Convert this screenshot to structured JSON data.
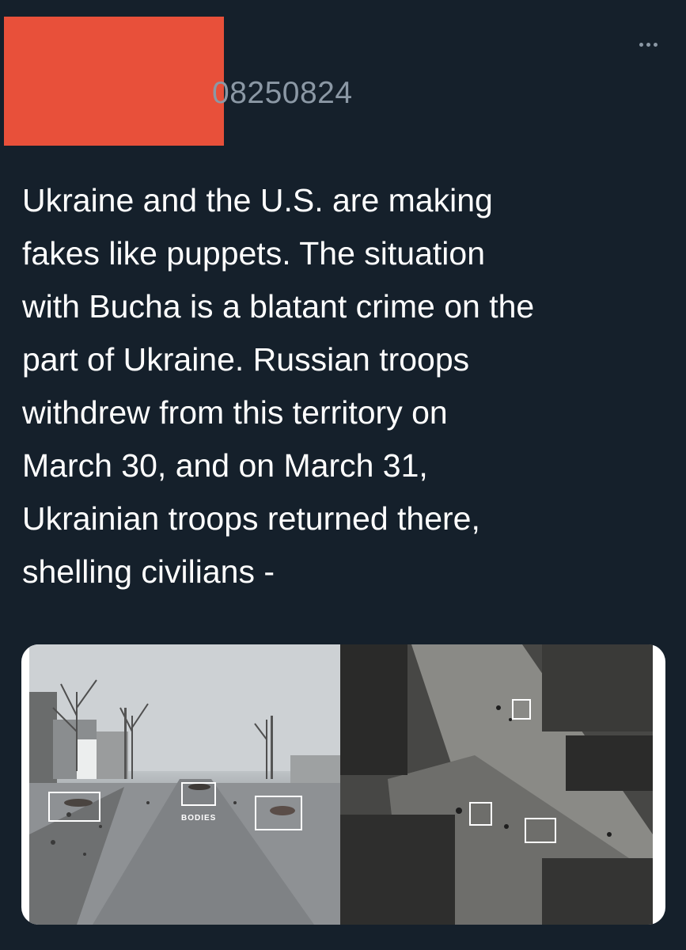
{
  "header": {
    "handle_suffix": "08250824",
    "more_label": "More"
  },
  "tweet": {
    "text": "Ukraine and the U.S. are making\nfakes like puppets. The situation\nwith Bucha is a blatant crime on the\npart of Ukraine. Russian troops\nwithdrew from this territory on\nMarch 30, and on March 31,\nUkrainian troops returned there,\nshelling civilians -"
  },
  "media": {
    "caption": "BODIES",
    "colors": {
      "background": "#15202b",
      "redaction": "#e8503a",
      "muted": "#8b98a5"
    }
  }
}
